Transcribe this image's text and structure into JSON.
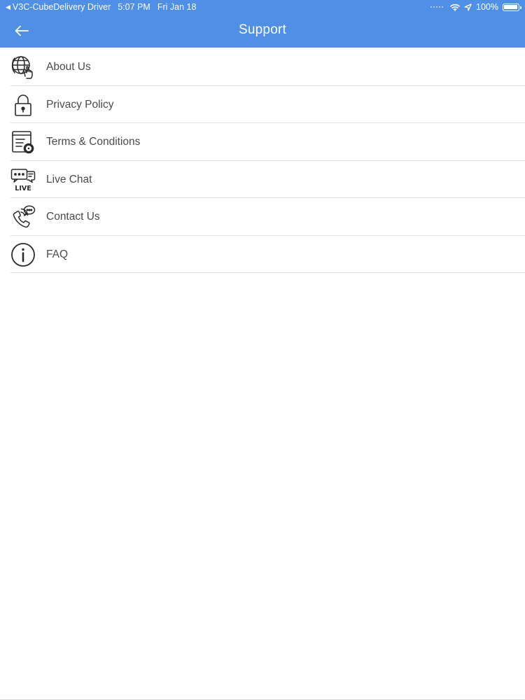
{
  "status_bar": {
    "app_back_label": "V3C-CubeDelivery Driver",
    "time": "5:07 PM",
    "date": "Fri Jan 18",
    "battery_text": "100%",
    "battery_level": 1.0,
    "icons": [
      "back-arrow-icon",
      "wifi-icon",
      "location-icon",
      "battery-icon"
    ]
  },
  "nav": {
    "title": "Support",
    "back_icon": "arrow-left-icon"
  },
  "colors": {
    "header_bg": "#4f8fe6",
    "header_text": "#ffffff",
    "item_text": "#4a4a4a",
    "icon": "#2b2b2b",
    "divider": "#e2e2e2"
  },
  "menu": {
    "items": [
      {
        "id": "about",
        "label": "About Us",
        "icon": "globe-hand-icon"
      },
      {
        "id": "privacy",
        "label": "Privacy Policy",
        "icon": "lock-icon"
      },
      {
        "id": "terms",
        "label": "Terms & Conditions",
        "icon": "document-gear-icon"
      },
      {
        "id": "live-chat",
        "label": "Live Chat",
        "icon": "live-chat-icon"
      },
      {
        "id": "contact",
        "label": "Contact Us",
        "icon": "phone-bubble-icon"
      },
      {
        "id": "faq",
        "label": "FAQ",
        "icon": "info-icon"
      }
    ]
  }
}
